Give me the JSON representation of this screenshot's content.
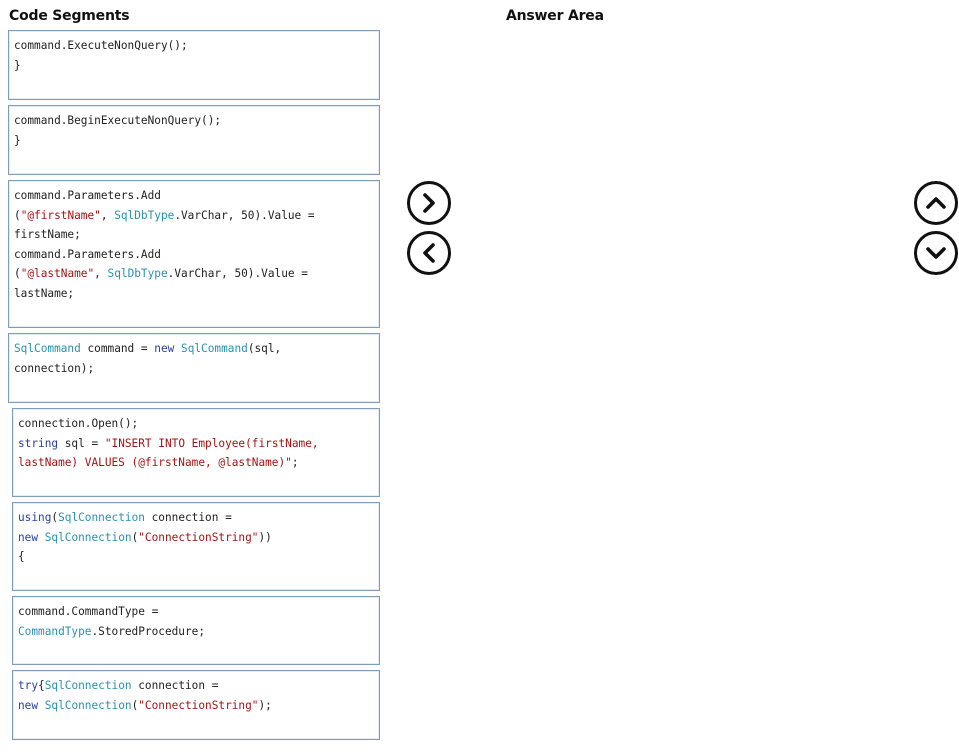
{
  "headings": {
    "code_segments": "Code Segments",
    "answer_area": "Answer Area"
  },
  "icons": {
    "move_right": "chevron-right-icon",
    "move_left": "chevron-left-icon",
    "move_up": "chevron-up-icon",
    "move_down": "chevron-down-icon"
  },
  "colors": {
    "keyword": "#2b3fa0",
    "type": "#2b91af",
    "string": "#a31515",
    "text": "#222222",
    "border": "#7f9db9"
  },
  "segments": [
    {
      "lines": [
        [
          {
            "t": "command.ExecuteNonQuery();",
            "c": ""
          }
        ],
        [
          {
            "t": "}",
            "c": ""
          }
        ]
      ]
    },
    {
      "lines": [
        [
          {
            "t": "command.BeginExecuteNonQuery();",
            "c": ""
          }
        ],
        [
          {
            "t": "}",
            "c": ""
          }
        ]
      ]
    },
    {
      "lines": [
        [
          {
            "t": "command.Parameters.Add",
            "c": ""
          }
        ],
        [
          {
            "t": "(",
            "c": ""
          },
          {
            "t": "\"@firstName\"",
            "c": "st"
          },
          {
            "t": ", ",
            "c": ""
          },
          {
            "t": "SqlDbType",
            "c": "ty"
          },
          {
            "t": ".VarChar, 50).Value =",
            "c": ""
          }
        ],
        [
          {
            "t": "firstName;",
            "c": ""
          }
        ],
        [
          {
            "t": "command.Parameters.Add",
            "c": ""
          }
        ],
        [
          {
            "t": "(",
            "c": ""
          },
          {
            "t": "\"@lastName\"",
            "c": "st"
          },
          {
            "t": ", ",
            "c": ""
          },
          {
            "t": "SqlDbType",
            "c": "ty"
          },
          {
            "t": ".VarChar, 50).Value =",
            "c": ""
          }
        ],
        [
          {
            "t": "lastName;",
            "c": ""
          }
        ]
      ]
    },
    {
      "lines": [
        [
          {
            "t": "SqlCommand",
            "c": "ty"
          },
          {
            "t": " command = ",
            "c": ""
          },
          {
            "t": "new",
            "c": "kw"
          },
          {
            "t": " ",
            "c": ""
          },
          {
            "t": "SqlCommand",
            "c": "ty"
          },
          {
            "t": "(sql,",
            "c": ""
          }
        ],
        [
          {
            "t": "connection);",
            "c": ""
          }
        ]
      ]
    },
    {
      "lines": [
        [
          {
            "t": "connection.Open();",
            "c": ""
          }
        ],
        [
          {
            "t": "string",
            "c": "kw"
          },
          {
            "t": " sql = ",
            "c": ""
          },
          {
            "t": "\"INSERT INTO Employee(firstName,",
            "c": "st"
          }
        ],
        [
          {
            "t": "lastName) VALUES (@firstName, @lastName)\"",
            "c": "st"
          },
          {
            "t": ";",
            "c": ""
          }
        ]
      ]
    },
    {
      "lines": [
        [
          {
            "t": "using",
            "c": "kw"
          },
          {
            "t": "(",
            "c": ""
          },
          {
            "t": "SqlConnection",
            "c": "ty"
          },
          {
            "t": " connection =",
            "c": ""
          }
        ],
        [
          {
            "t": "new",
            "c": "kw"
          },
          {
            "t": " ",
            "c": ""
          },
          {
            "t": "SqlConnection",
            "c": "ty"
          },
          {
            "t": "(",
            "c": ""
          },
          {
            "t": "\"ConnectionString\"",
            "c": "st"
          },
          {
            "t": "))",
            "c": ""
          }
        ],
        [
          {
            "t": "{",
            "c": ""
          }
        ]
      ]
    },
    {
      "lines": [
        [
          {
            "t": "command.CommandType =",
            "c": ""
          }
        ],
        [
          {
            "t": "CommandType",
            "c": "ty"
          },
          {
            "t": ".StoredProcedure;",
            "c": ""
          }
        ]
      ]
    },
    {
      "lines": [
        [
          {
            "t": "try",
            "c": "kw"
          },
          {
            "t": "{",
            "c": ""
          },
          {
            "t": "SqlConnection",
            "c": "ty"
          },
          {
            "t": " connection =",
            "c": ""
          }
        ],
        [
          {
            "t": "new",
            "c": "kw"
          },
          {
            "t": " ",
            "c": ""
          },
          {
            "t": "SqlConnection",
            "c": "ty"
          },
          {
            "t": "(",
            "c": ""
          },
          {
            "t": "\"ConnectionString\"",
            "c": "st"
          },
          {
            "t": ");",
            "c": ""
          }
        ]
      ]
    }
  ]
}
